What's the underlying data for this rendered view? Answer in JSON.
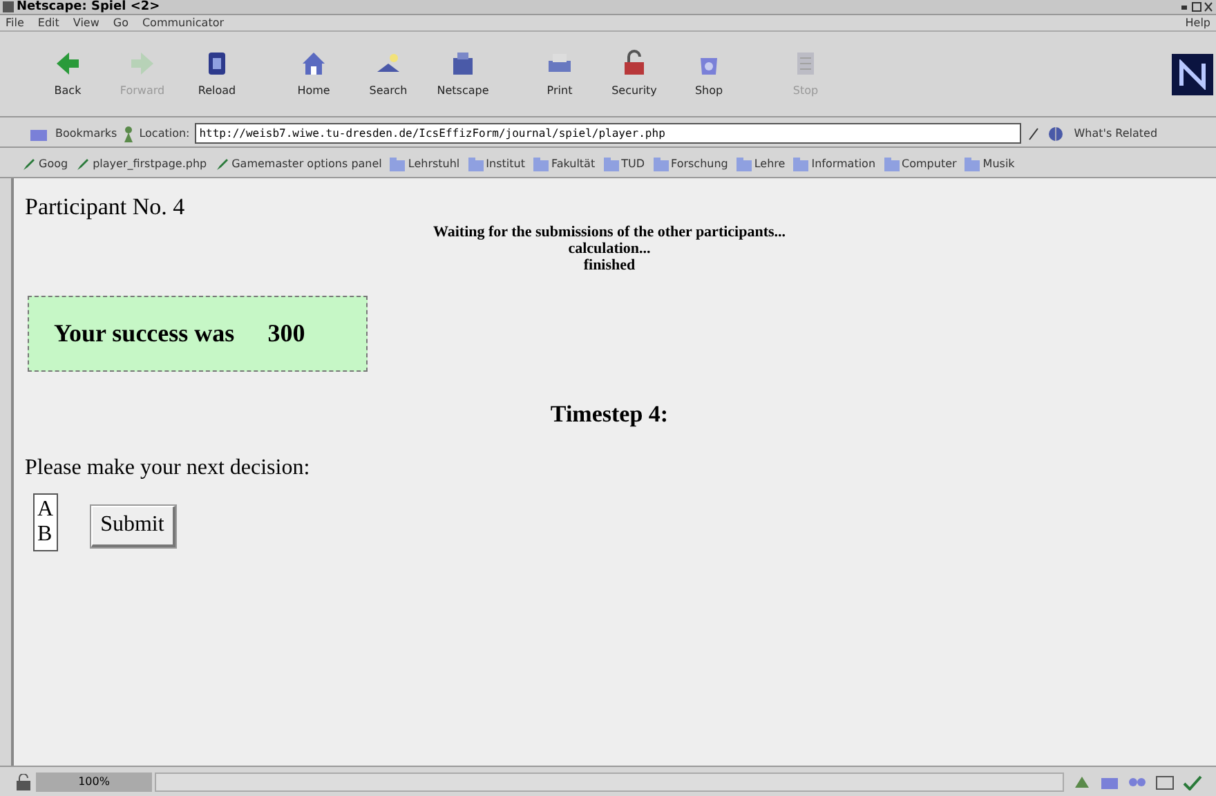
{
  "window": {
    "title": "Netscape: Spiel <2>"
  },
  "menu": [
    "File",
    "Edit",
    "View",
    "Go",
    "Communicator"
  ],
  "help_menu": "Help",
  "toolbar": [
    {
      "kind": "back",
      "label": "Back",
      "disabled": false
    },
    {
      "kind": "forward",
      "label": "Forward",
      "disabled": true
    },
    {
      "kind": "reload",
      "label": "Reload",
      "disabled": false
    },
    {
      "kind": "home",
      "label": "Home",
      "disabled": false
    },
    {
      "kind": "search",
      "label": "Search",
      "disabled": false
    },
    {
      "kind": "netscape",
      "label": "Netscape",
      "disabled": false
    },
    {
      "kind": "print",
      "label": "Print",
      "disabled": false
    },
    {
      "kind": "security",
      "label": "Security",
      "disabled": false
    },
    {
      "kind": "shop",
      "label": "Shop",
      "disabled": false
    },
    {
      "kind": "stop",
      "label": "Stop",
      "disabled": true
    }
  ],
  "location_bar": {
    "bookmarks_label": "Bookmarks",
    "location_label": "Location:",
    "url": "http://weisb7.wiwe.tu-dresden.de/IcsEffizForm/journal/spiel/player.php",
    "related_label": "What's Related"
  },
  "personal_bar": [
    {
      "kind": "link",
      "label": "Goog"
    },
    {
      "kind": "link",
      "label": "player_firstpage.php"
    },
    {
      "kind": "link",
      "label": "Gamemaster options panel"
    },
    {
      "kind": "folder",
      "label": "Lehrstuhl"
    },
    {
      "kind": "folder",
      "label": "Institut"
    },
    {
      "kind": "folder",
      "label": "Fakultät"
    },
    {
      "kind": "folder",
      "label": "TUD"
    },
    {
      "kind": "folder",
      "label": "Forschung"
    },
    {
      "kind": "folder",
      "label": "Lehre"
    },
    {
      "kind": "folder",
      "label": "Information"
    },
    {
      "kind": "folder",
      "label": "Computer"
    },
    {
      "kind": "folder",
      "label": "Musik"
    }
  ],
  "page": {
    "participant": "Participant No. 4",
    "status_lines": [
      "Waiting for the submissions of the other participants...",
      "calculation...",
      "finished"
    ],
    "success_label": "Your success was",
    "success_value": "300",
    "timestep": "Timestep 4:",
    "prompt": "Please make your next decision:",
    "options": [
      {
        "label": "A",
        "selected": false
      },
      {
        "label": "B",
        "selected": false
      }
    ],
    "submit": "Submit"
  },
  "status_bar": {
    "progress": "100%"
  }
}
